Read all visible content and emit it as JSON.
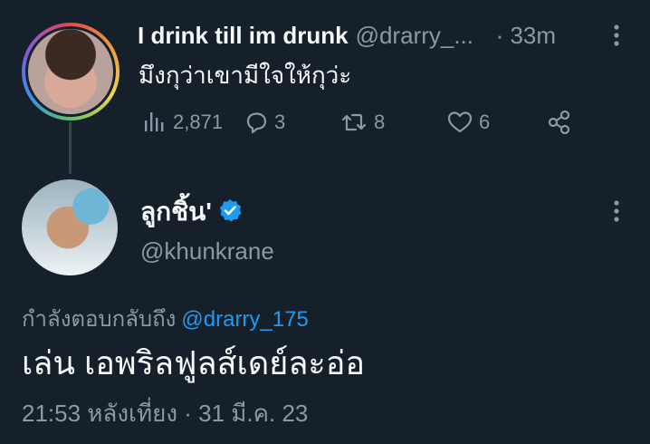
{
  "parent_tweet": {
    "display_name": "I drink till im drunk",
    "handle": "@drarry_...",
    "time": "· 33m",
    "text": "มึงกุว่าเขามีใจให้กุว่ะ",
    "stats": {
      "views": "2,871",
      "replies": "3",
      "retweets": "8",
      "likes": "6"
    },
    "icons": [
      "views-icon",
      "reply-icon",
      "retweet-icon",
      "like-icon",
      "share-icon",
      "more-icon"
    ]
  },
  "main_tweet": {
    "display_name": "ลูกชิ้น'",
    "handle": "@khunkrane",
    "verified": true,
    "replying_to_label": "กำลังตอบกลับถึง",
    "replying_to_mention": "@drarry_175",
    "text": "เล่น เอพริลฟูลส์เดย์ละอ่อ",
    "meta": "21:53 หลังเที่ยง · 31 มี.ค. 23"
  },
  "colors": {
    "background": "#15202b",
    "text_primary": "#f7f9f9",
    "text_secondary": "#8b98a5",
    "accent": "#1d9bf0",
    "thread_line": "#38444d"
  }
}
